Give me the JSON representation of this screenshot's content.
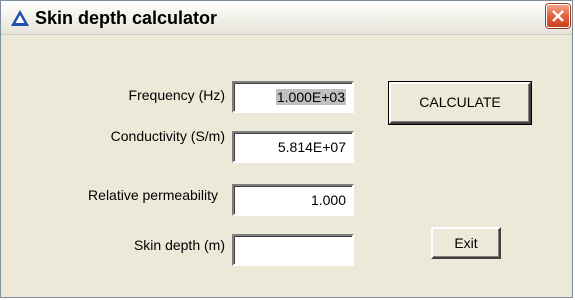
{
  "window": {
    "title": "Skin depth calculator"
  },
  "icons": {
    "app": "triangle-app-icon",
    "close": "close-icon"
  },
  "form": {
    "frequency": {
      "label": "Frequency (Hz)",
      "value": "1.000E+03"
    },
    "conductivity": {
      "label": "Conductivity (S/m)",
      "value": "5.814E+07"
    },
    "permeability": {
      "label": "Relative permeability",
      "value": "1.000"
    },
    "skin_depth": {
      "label": "Skin depth (m)",
      "value": ""
    }
  },
  "buttons": {
    "calculate": "CALCULATE",
    "exit": "Exit"
  },
  "colors": {
    "face": "#ece9d8",
    "close_red": "#e0623f",
    "icon_blue": "#1f4fae"
  }
}
